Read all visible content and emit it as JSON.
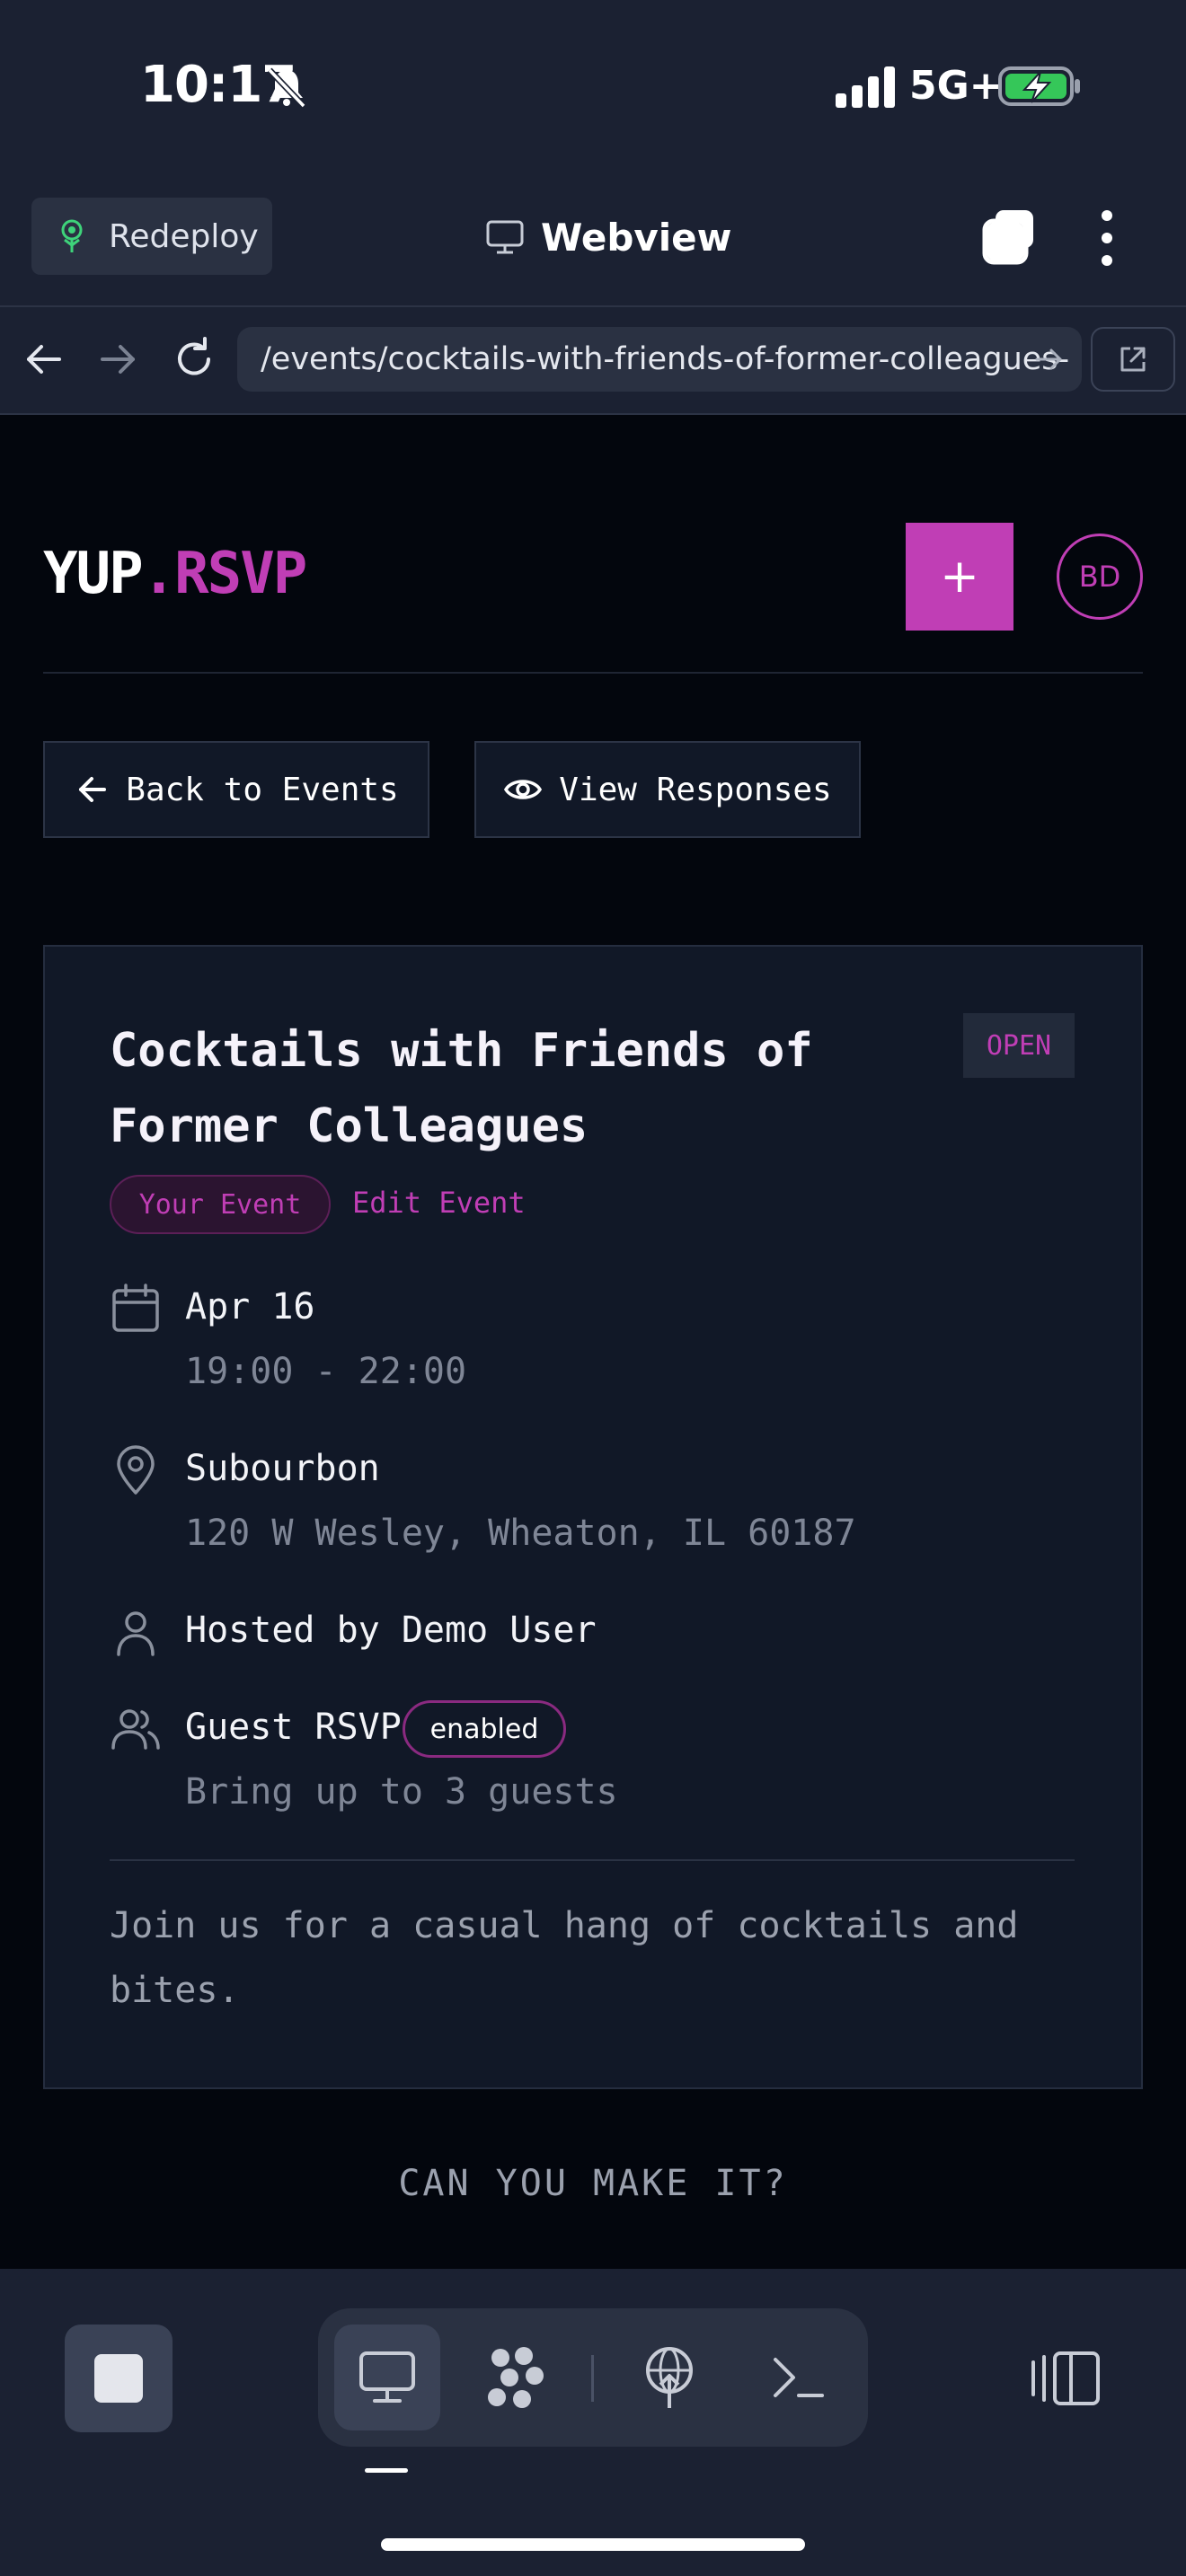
{
  "status_bar": {
    "time": "10:17",
    "network": "5G+"
  },
  "browser": {
    "redeploy_label": "Redeploy",
    "title": "Webview",
    "url": "/events/cocktails-with-friends-of-former-colleagues-"
  },
  "header": {
    "logo_part1": "YUP",
    "logo_part2": ".RSVP",
    "add_label": "+",
    "avatar_initials": "BD"
  },
  "actions": {
    "back_label": "Back to Events",
    "responses_label": "View Responses"
  },
  "event": {
    "title": "Cocktails with Friends of Former Colleagues",
    "status": "OPEN",
    "owner_badge": "Your Event",
    "edit_label": "Edit Event",
    "date": "Apr 16",
    "time": "19:00 - 22:00",
    "venue": "Subourbon",
    "address": "120 W Wesley, Wheaton, IL 60187",
    "host": "Hosted by Demo User",
    "guest_rsvp_label": "Guest RSVP",
    "guest_rsvp_badge": "enabled",
    "guest_limit": "Bring up to 3 guests",
    "description": "Join us for a casual hang of cocktails and bites."
  },
  "rsvp": {
    "question": "CAN YOU MAKE IT?"
  },
  "colors": {
    "accent": "#c03eb5",
    "background": "#03060d",
    "card": "#111827",
    "chrome": "#1b2132"
  }
}
